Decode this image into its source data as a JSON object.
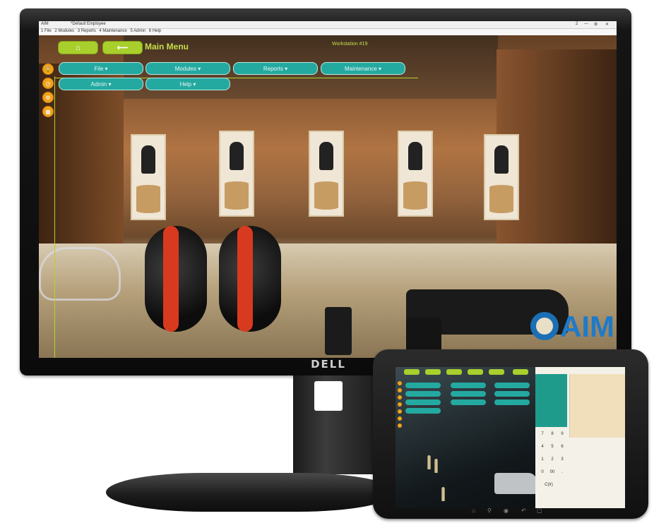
{
  "app": {
    "window_title": "*Default Employee",
    "window_icon_label": "AIM",
    "window_controls": [
      "2",
      "—",
      "⚙",
      "✕"
    ],
    "menu_items": [
      "1 File",
      "2 Modules",
      "3 Reports",
      "4 Maintenance",
      "5 Admin",
      "6 Help"
    ],
    "home_icon": "home-icon",
    "back_icon": "arrow-left-icon",
    "page_title": "Main Menu",
    "workstation": "Workstation #19",
    "side_icons": [
      "lock-icon",
      "clock-icon",
      "gear-icon",
      "calendar-icon"
    ],
    "main_menu_buttons": [
      {
        "label": "File",
        "caret": "▾"
      },
      {
        "label": "Modules",
        "caret": "▾"
      },
      {
        "label": "Reports",
        "caret": "▾"
      },
      {
        "label": "Maintenance",
        "caret": "▾"
      },
      {
        "label": "Admin",
        "caret": "▾"
      },
      {
        "label": "Help",
        "caret": "▾"
      }
    ]
  },
  "monitor": {
    "brand": "DELL"
  },
  "logo": {
    "text": "AIM",
    "color": "#1f7ac8"
  },
  "tablet": {
    "keypad": [
      "7",
      "8",
      "9",
      "4",
      "5",
      "6",
      "1",
      "2",
      "3",
      "0",
      "00",
      ".",
      "C(lr)"
    ],
    "nav_icons": [
      "home-icon",
      "search-icon",
      "android-icon",
      "back-icon",
      "recent-icon"
    ]
  },
  "colors": {
    "accent_green": "#a9cf2c",
    "menu_teal": "#24a9a1",
    "side_orange": "#f0a21a",
    "title_green": "#c6df4a"
  }
}
